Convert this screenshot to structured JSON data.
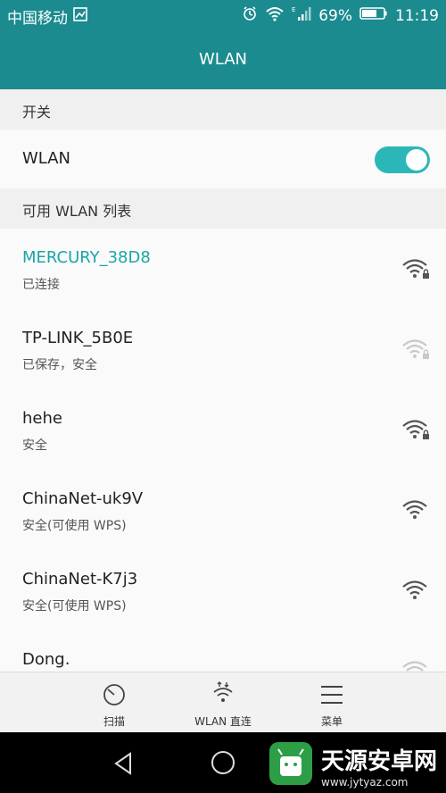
{
  "status_bar": {
    "carrier": "中国移动",
    "battery_percent": "69%",
    "time": "11:19"
  },
  "header": {
    "title": "WLAN"
  },
  "sections": {
    "switch_label": "开关",
    "list_label": "可用 WLAN 列表"
  },
  "wlan_toggle": {
    "label": "WLAN",
    "enabled": true
  },
  "networks": [
    {
      "name": "MERCURY_38D8",
      "status": "已连接",
      "connected": true,
      "icon": "wifi-lock-icon"
    },
    {
      "name": "TP-LINK_5B0E",
      "status": "已保存，安全",
      "connected": false,
      "icon": "wifi-lock-icon"
    },
    {
      "name": "hehe",
      "status": "安全",
      "connected": false,
      "icon": "wifi-lock-icon"
    },
    {
      "name": "ChinaNet-uk9V",
      "status": "安全(可使用 WPS)",
      "connected": false,
      "icon": "wifi-icon"
    },
    {
      "name": "ChinaNet-K7j3",
      "status": "安全(可使用 WPS)",
      "connected": false,
      "icon": "wifi-icon"
    },
    {
      "name": "Dong.",
      "status": "",
      "connected": false,
      "icon": "wifi-icon"
    }
  ],
  "bottom_toolbar": [
    {
      "label": "扫描",
      "icon": "scan-icon"
    },
    {
      "label": "WLAN 直连",
      "icon": "wifi-direct-icon"
    },
    {
      "label": "菜单",
      "icon": "menu-icon"
    }
  ],
  "watermark": {
    "text": "天源安卓网",
    "url": "www.jytyaz.com"
  },
  "colors": {
    "accent": "#1b8b8f",
    "connected_text": "#1aa6a6",
    "toggle_on": "#2bb7b7"
  }
}
